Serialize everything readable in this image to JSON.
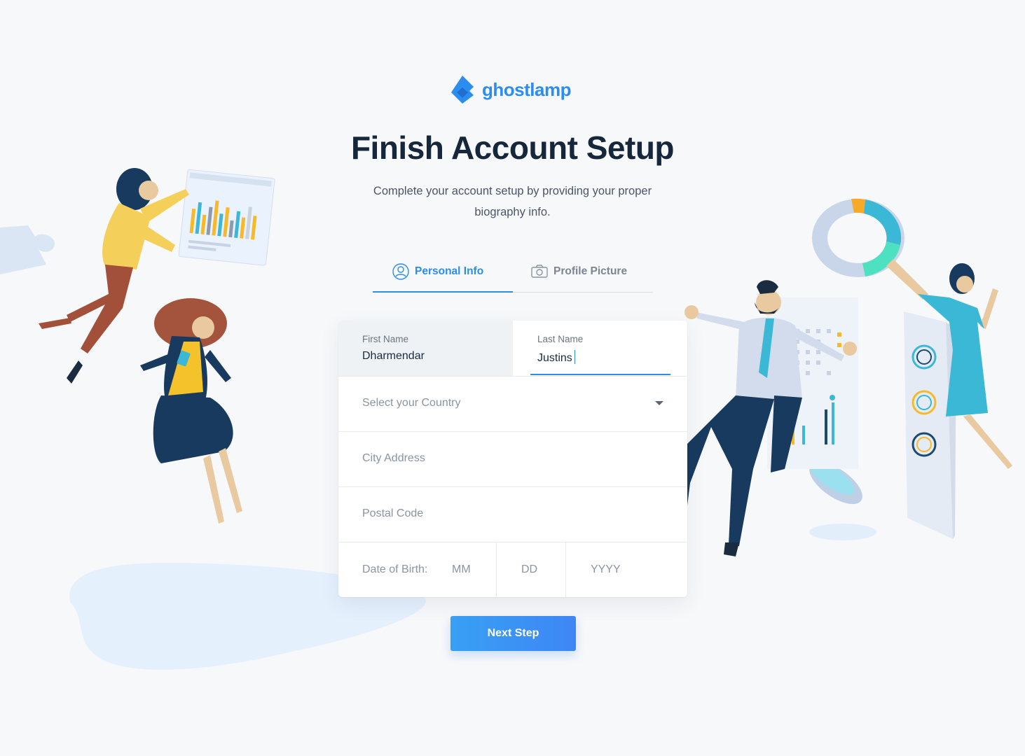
{
  "brand": {
    "name": "ghostlamp",
    "color": "#2b8def",
    "icon": "ghostlamp-logo-icon"
  },
  "header": {
    "title": "Finish Account Setup",
    "subtitle": "Complete your account setup by providing your proper biography info."
  },
  "tabs": [
    {
      "label": "Personal Info",
      "icon": "user-icon",
      "active": true
    },
    {
      "label": "Profile Picture",
      "icon": "camera-icon",
      "active": false
    }
  ],
  "form": {
    "first_name": {
      "label": "First Name",
      "value": "Dharmendar"
    },
    "last_name": {
      "label": "Last Name",
      "value": "Justins"
    },
    "country": {
      "placeholder": "Select your Country",
      "icon": "chevron-down-icon"
    },
    "city": {
      "placeholder": "City Address"
    },
    "postal": {
      "placeholder": "Postal Code"
    },
    "dob": {
      "label": "Date of Birth:",
      "mm": "MM",
      "dd": "DD",
      "yyyy": "YYYY"
    }
  },
  "actions": {
    "next_label": "Next Step"
  },
  "colors": {
    "accent": "#2b8def",
    "background": "#f7f8fa",
    "title": "#17273b"
  }
}
